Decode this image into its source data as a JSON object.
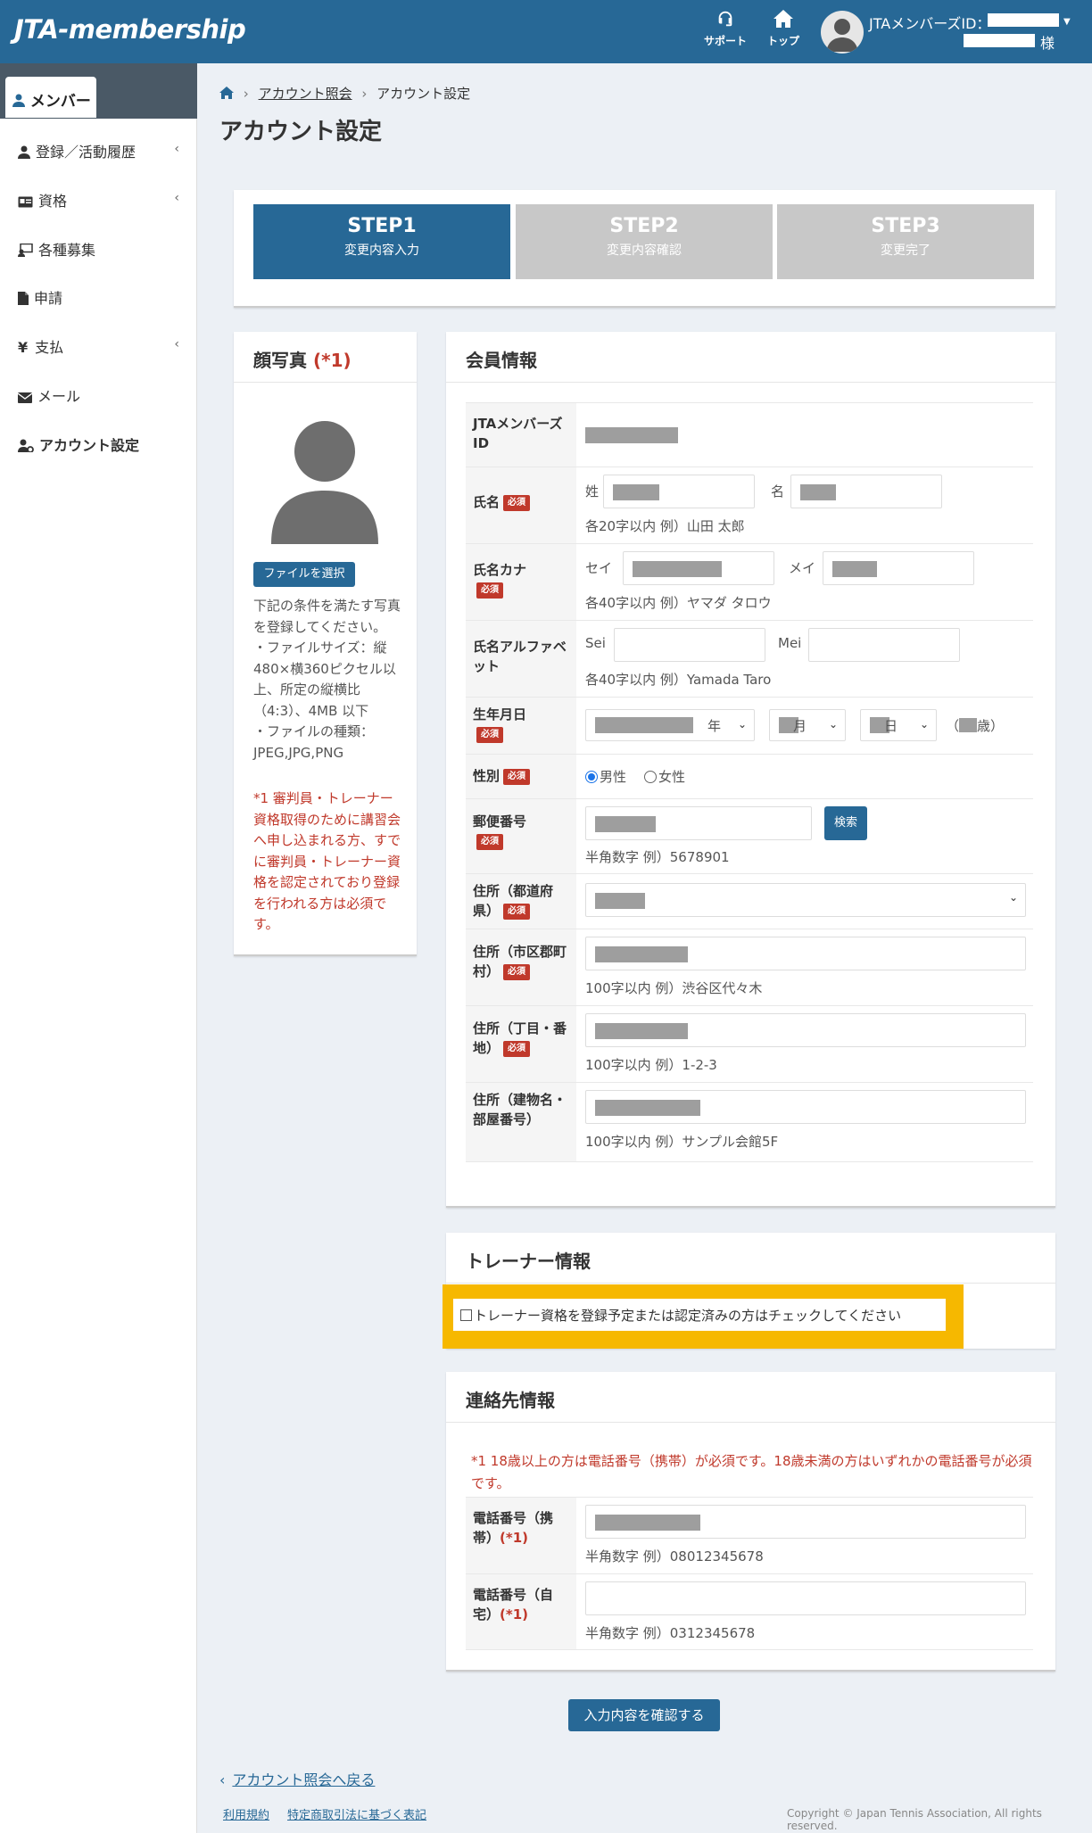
{
  "header": {
    "logo": "JTA-membership",
    "support_label": "サポート",
    "top_label": "トップ",
    "user_id_label": "JTAメンバーズID：",
    "user_suffix": "様"
  },
  "sidebar": {
    "tab_label": "メンバー",
    "items": [
      {
        "label": "登録／活動履歴",
        "icon": "user-icon",
        "chevron": "‹"
      },
      {
        "label": "資格",
        "icon": "id-card-icon",
        "chevron": "‹"
      },
      {
        "label": "各種募集",
        "icon": "recruit-icon",
        "chevron": ""
      },
      {
        "label": "申請",
        "icon": "file-icon",
        "chevron": ""
      },
      {
        "label": "支払",
        "icon": "yen-icon",
        "chevron": "‹"
      },
      {
        "label": "メール",
        "icon": "mail-icon",
        "chevron": ""
      },
      {
        "label": "アカウント設定",
        "icon": "user-gear-icon",
        "chevron": ""
      }
    ]
  },
  "breadcrumb": {
    "link": "アカウント照会",
    "current": "アカウント設定"
  },
  "page_title": "アカウント設定",
  "steps": [
    {
      "num": "STEP1",
      "sub": "変更内容入力",
      "active": true
    },
    {
      "num": "STEP2",
      "sub": "変更内容確認",
      "active": false
    },
    {
      "num": "STEP3",
      "sub": "変更完了",
      "active": false
    }
  ],
  "photo": {
    "title": "顔写真",
    "title_mark": "(*1)",
    "file_button": "ファイルを選択",
    "desc": "下記の条件を満たす写真を登録してください。\n・ファイルサイズ：縦480×横360ピクセル以上、所定の縦横比（4:3）、4MB 以下\n・ファイルの種類：JPEG,JPG,PNG",
    "note": "*1 審判員・トレーナー資格取得のために講習会へ申し込まれる方、すでに審判員・トレーナー資格を認定されており登録を行われる方は必須です。"
  },
  "member": {
    "title": "会員情報",
    "required_badge": "必須",
    "labels": {
      "member_id": "JTAメンバーズID",
      "name": "氏名",
      "kana": "氏名カナ",
      "alpha": "氏名アルファベット",
      "birth": "生年月日",
      "gender": "性別",
      "postal": "郵便番号",
      "pref": "住所（都道府県）",
      "city": "住所（市区郡町村）",
      "street": "住所（丁目・番地）",
      "building": "住所（建物名・部屋番号）"
    },
    "sei_label": "姓",
    "mei_label": "名",
    "name_hint": "各20字以内 例）山田 太郎",
    "kana_sei": "セイ",
    "kana_mei": "メイ",
    "kana_hint": "各40字以内 例）ヤマダ タロウ",
    "alpha_sei": "Sei",
    "alpha_mei": "Mei",
    "alpha_hint": "各40字以内 例）Yamada Taro",
    "year_suffix": "年",
    "month_suffix": "月",
    "day_suffix": "日",
    "age_open": "（",
    "age_close": "歳）",
    "gender_male": "男性",
    "gender_female": "女性",
    "postal_search": "検索",
    "postal_hint": "半角数字 例）5678901",
    "city_hint": "100字以内 例）渋谷区代々木",
    "street_hint": "100字以内 例）1-2-3",
    "building_hint": "100字以内 例）サンプル会館5F"
  },
  "trainer": {
    "title": "トレーナー情報",
    "checkbox_label": "トレーナー資格を登録予定または認定済みの方はチェックしてください"
  },
  "contact": {
    "title": "連絡先情報",
    "note": "*1 18歳以上の方は電話番号（携帯）が必須です。18歳未満の方はいずれかの電話番号が必須です。",
    "mobile_label": "電話番号（携帯）",
    "home_label": "電話番号（自宅）",
    "mark": "(*1)",
    "mobile_hint": "半角数字 例）08012345678",
    "home_hint": "半角数字 例）0312345678"
  },
  "confirm_button": "入力内容を確認する",
  "footer": {
    "back_link": "アカウント照会へ戻る",
    "terms": "利用規約",
    "commerce": "特定商取引法に基づく表記",
    "copyright": "Copyright © Japan Tennis Association, All rights reserved."
  },
  "colors": {
    "primary": "#276896",
    "step_inactive": "#c8c8c8",
    "required": "#c0392b",
    "highlight": "#f6b800"
  }
}
